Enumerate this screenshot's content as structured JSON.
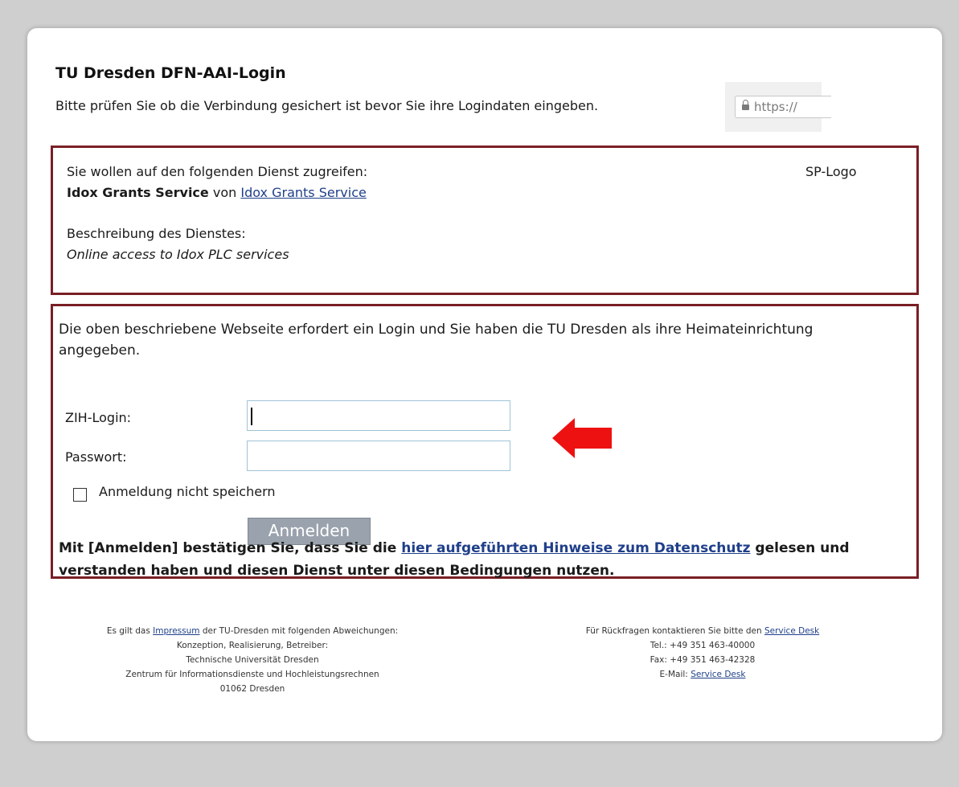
{
  "header": {
    "title": "TU Dresden DFN-AAI-Login",
    "subtitle": "Bitte prüfen Sie ob die Verbindung gesichert ist bevor Sie ihre Logindaten eingeben.",
    "url_prefix": "https://"
  },
  "service": {
    "access_text": "Sie wollen auf den folgenden Dienst zugreifen:",
    "name": "Idox Grants Service",
    "von": "von",
    "provider": "Idox Grants Service",
    "sp_logo": "SP-Logo",
    "description_label": "Beschreibung des Dienstes:",
    "description": "Online access to Idox PLC services"
  },
  "login": {
    "intro": "Die oben beschriebene Webseite erfordert ein Login und Sie haben die TU Dresden als ihre Heimateinrichtung angegeben.",
    "username_label": "ZIH-Login:",
    "username_value": "",
    "password_label": "Passwort:",
    "password_value": "",
    "remember_label": "Anmeldung nicht speichern",
    "remember_checked": false,
    "submit_label": "Anmelden",
    "consent_pre": "Mit [Anmelden] bestätigen Sie, dass Sie die ",
    "consent_link": "hier aufgeführten Hinweise zum Datenschutz",
    "consent_post": " gelesen und verstanden haben und diesen Dienst unter diesen Bedingungen nutzen."
  },
  "annotation": {
    "arrow_color": "#ee1111"
  },
  "footer": {
    "left_pre": "Es gilt das ",
    "left_link": "Impressum",
    "left_post": " der TU-Dresden mit folgenden Abweichungen:",
    "left_line2": "Konzeption, Realisierung, Betreiber:",
    "left_line3": "Technische Universität Dresden",
    "left_line4": "Zentrum für Informationsdienste und Hochleistungsrechnen",
    "left_line5": "01062 Dresden",
    "right_pre": "Für Rückfragen kontaktieren Sie bitte den ",
    "right_link": "Service Desk",
    "right_tel": "Tel.: +49 351 463-40000",
    "right_fax": "Fax: +49 351 463-42328",
    "right_email_label": "E-Mail: ",
    "right_email_link": "Service Desk"
  },
  "colors": {
    "border_accent": "#7a1f25",
    "link": "#1f3f8a",
    "button": "#9aa2ad"
  }
}
